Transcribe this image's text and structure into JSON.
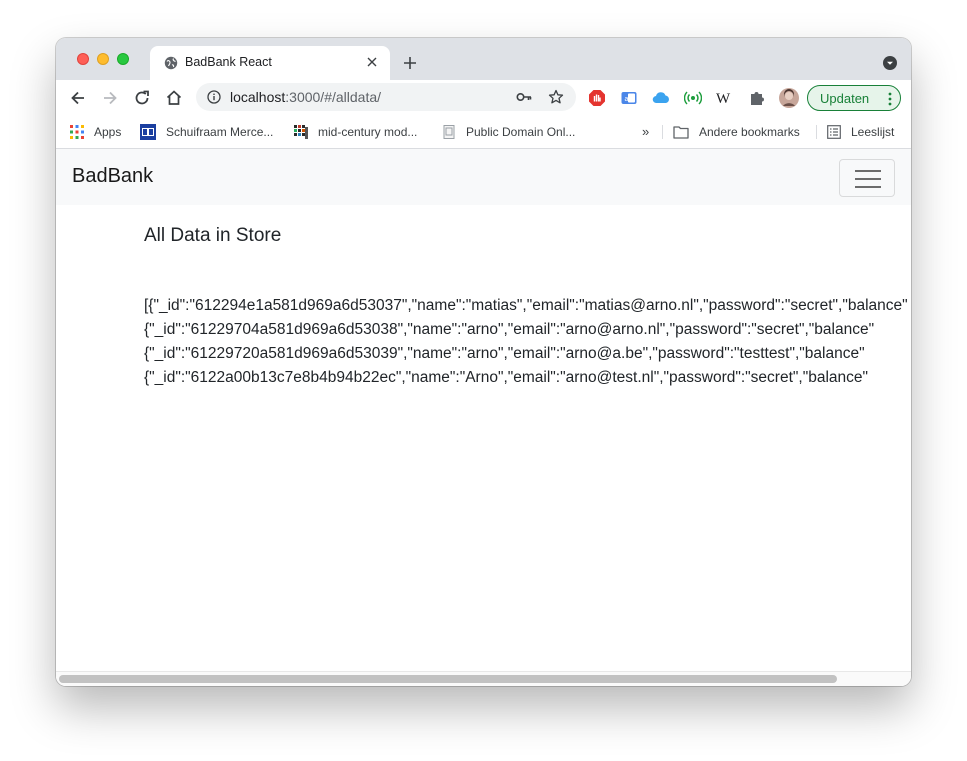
{
  "browser": {
    "tab": {
      "title": "BadBank React"
    },
    "address_bar": {
      "host": "localhost",
      "path": ":3000/#/alldata/"
    },
    "update_button": {
      "label": "Updaten"
    }
  },
  "bookmarks": [
    {
      "label": "Apps",
      "icon": "apps-grid-icon"
    },
    {
      "label": "Schuifraam Merce...",
      "icon": "site-favicon-icon"
    },
    {
      "label": "mid-century mod...",
      "icon": "site-favicon-icon"
    },
    {
      "label": "Public Domain Onl...",
      "icon": "page-favicon-icon"
    },
    {
      "label": "Andere bookmarks",
      "icon": "folder-icon"
    },
    {
      "label": "Leeslijst",
      "icon": "reading-list-icon"
    }
  ],
  "app": {
    "brand": "BadBank",
    "heading": "All Data in Store",
    "records": [
      "[{\"_id\":\"612294e1a581d969a6d53037\",\"name\":\"matias\",\"email\":\"matias@arno.nl\",\"password\":\"secret\",\"balance\"",
      "{\"_id\":\"61229704a581d969a6d53038\",\"name\":\"arno\",\"email\":\"arno@arno.nl\",\"password\":\"secret\",\"balance\"",
      "{\"_id\":\"61229720a581d969a6d53039\",\"name\":\"arno\",\"email\":\"arno@a.be\",\"password\":\"testtest\",\"balance\"",
      "{\"_id\":\"6122a00b13c7e8b4b94b22ec\",\"name\":\"Arno\",\"email\":\"arno@test.nl\",\"password\":\"secret\",\"balance\""
    ]
  }
}
